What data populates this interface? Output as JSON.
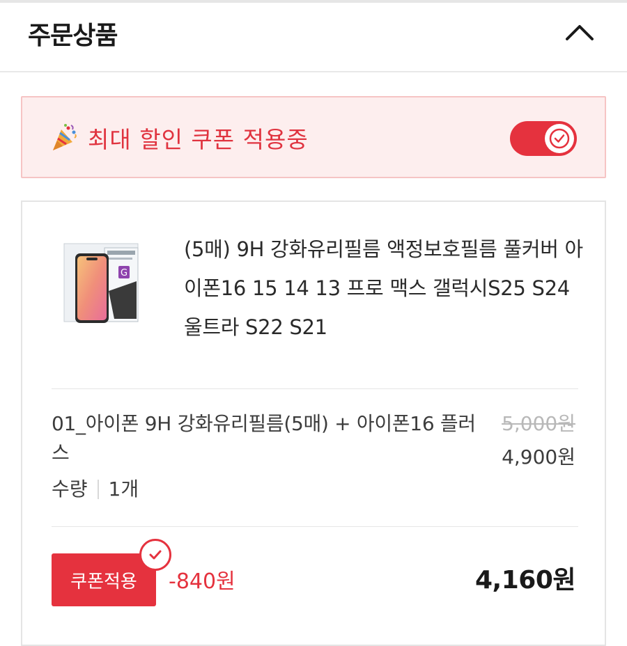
{
  "header": {
    "title": "주문상품",
    "collapse_icon": "chevron-up-icon"
  },
  "banner": {
    "icon": "party-popper-icon",
    "text": "최대 할인 쿠폰 적용중",
    "toggle_on": true
  },
  "product": {
    "name": "(5매) 9H 강화유리필름 액정보호필름 풀커버 아이폰16 15 14 13 프로 맥스 갤럭시S25 S24 울트라 S22 S21",
    "option": "01_아이폰 9H 강화유리필름(5매) + 아이폰16 플러스",
    "original_price": "5,000원",
    "sale_price": "4,900원",
    "quantity_label": "수량",
    "quantity_value": "1개",
    "coupon_button": "쿠폰적용",
    "discount": "-840원",
    "total": "4,160원"
  },
  "colors": {
    "accent": "#e5323e",
    "banner_bg": "#fdeeee",
    "banner_border": "#f6c4c4"
  }
}
